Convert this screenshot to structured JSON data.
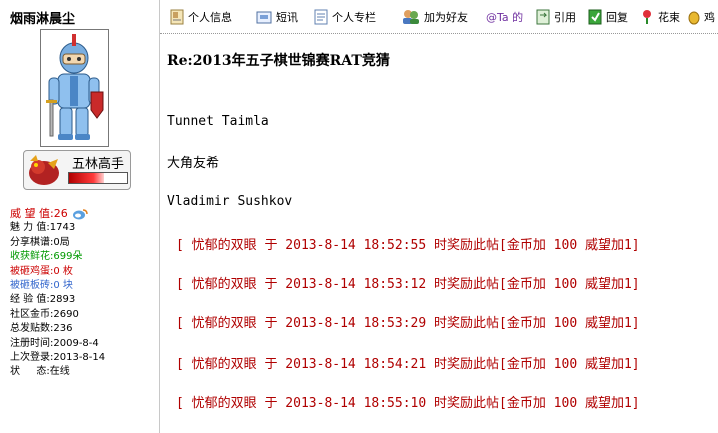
{
  "sidebar": {
    "username": "烟雨淋晨尘",
    "rank": {
      "name": "五林高手",
      "level_fraction": 0.6
    },
    "stats": [
      {
        "label": "威 望 值",
        "value": "26",
        "color": "#cc0000"
      },
      {
        "label": "魅 力 值",
        "value": "1743",
        "color": "#000000"
      },
      {
        "label": "分享棋谱",
        "value": "0局",
        "color": "#000000"
      },
      {
        "label": "收获鲜花",
        "value": "699朵",
        "color": "#009900"
      },
      {
        "label": "被砸鸡蛋",
        "value": "0 枚",
        "color": "#cc0000"
      },
      {
        "label": "被砸板砖",
        "value": "0 块",
        "color": "#3366cc"
      },
      {
        "label": "经 验 值",
        "value": "2893",
        "color": "#000000"
      },
      {
        "label": "社区金币",
        "value": "2690",
        "color": "#000000"
      },
      {
        "label": "总发贴数",
        "value": "236",
        "color": "#000000"
      },
      {
        "label": "注册时间",
        "value": "2009-8-4",
        "color": "#000000"
      },
      {
        "label": "上次登录",
        "value": "2013-8-14",
        "color": "#000000"
      },
      {
        "label": "状 　 态",
        "value": "在线",
        "color": "#000000"
      }
    ]
  },
  "toolbar": {
    "profile": "个人信息",
    "message": "短讯",
    "column": "个人专栏",
    "add_friend": "加为好友",
    "at": "@Ta 的",
    "quote": "引用",
    "reply": "回复",
    "flower": "花束",
    "egg": "鸡"
  },
  "post": {
    "title": "Re:2013年五子棋世锦赛RAT竞猜",
    "lines": [
      "Tunnet Taimla",
      "大角友希",
      "Vladimir Sushkov"
    ],
    "rewards": [
      "[ 忧郁的双眼 于 2013-8-14 18:52:55 时奖励此帖[金币加 100 威望加1]",
      "[ 忧郁的双眼 于 2013-8-14 18:53:12 时奖励此帖[金币加 100 威望加1]",
      "[ 忧郁的双眼 于 2013-8-14 18:53:29 时奖励此帖[金币加 100 威望加1]",
      "[ 忧郁的双眼 于 2013-8-14 18:54:21 时奖励此帖[金币加 100 威望加1]",
      "[ 忧郁的双眼 于 2013-8-14 18:55:10 时奖励此帖[金币加 100 威望加1]"
    ]
  }
}
